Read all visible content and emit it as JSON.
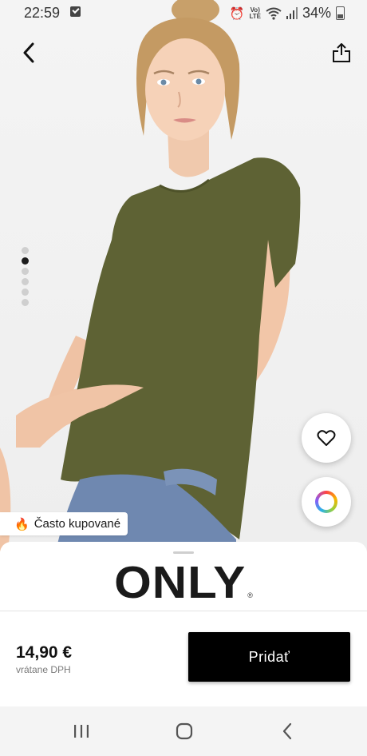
{
  "status_bar": {
    "time": "22:59",
    "battery": "34%",
    "volte_top": "Vo)",
    "volte_bottom": "LTE"
  },
  "product": {
    "badge_label": "Často kupované",
    "badge_icon": "fire-icon",
    "gallery_total": 6,
    "gallery_active_index": 1,
    "brand": "ONLY",
    "brand_mark": "®",
    "price": "14,90 €",
    "price_note": "vrátane DPH",
    "add_button_label": "Pridať"
  },
  "icons": {
    "back": "chevron-left-icon",
    "share": "share-icon",
    "wishlist": "heart-icon",
    "colors": "color-wheel-icon"
  },
  "colors": {
    "shirt": "#5e6234",
    "button": "#000000",
    "background": "#f0f0f0"
  }
}
